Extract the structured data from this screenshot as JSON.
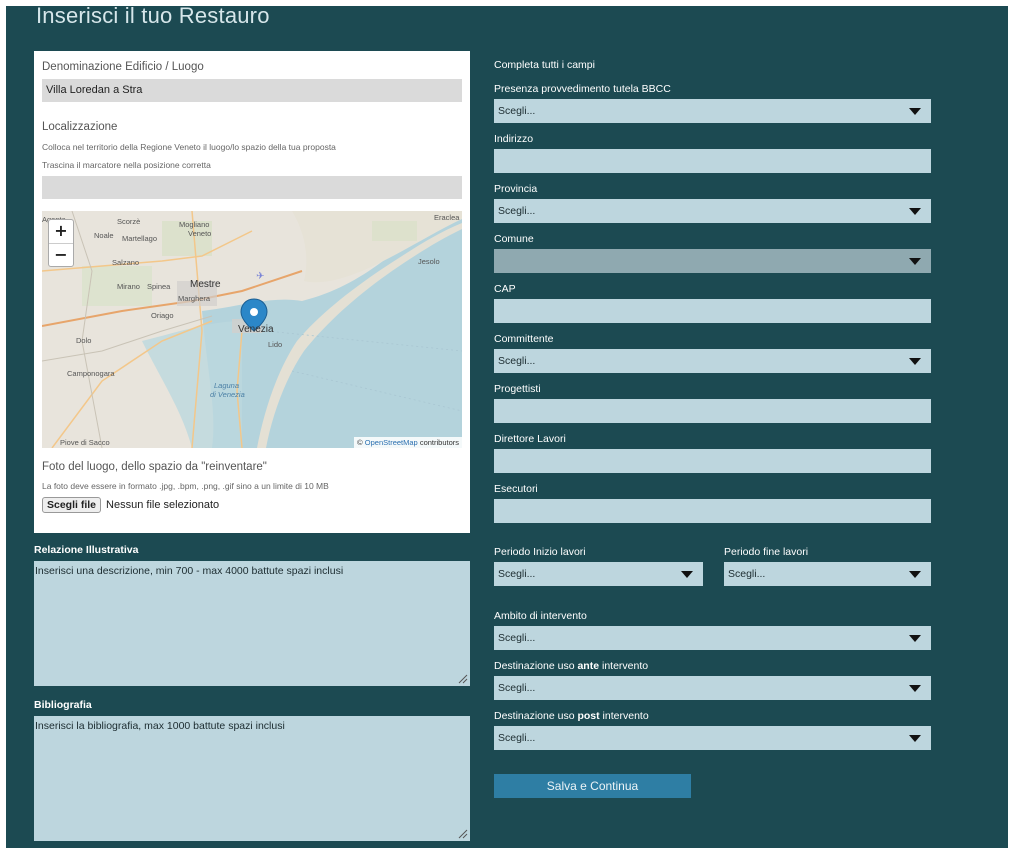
{
  "title": "Inserisci il tuo Restauro",
  "left": {
    "denominazione_label": "Denominazione Edificio / Luogo",
    "denominazione_value": "Villa Loredan a Stra",
    "localizzazione_label": "Localizzazione",
    "loc_hint1": "Colloca nel territorio della Regione Veneto il luogo/lo spazio della tua proposta",
    "loc_hint2": "Trascina il marcatore nella posizione corretta",
    "map": {
      "zoom_in": "+",
      "zoom_out": "−",
      "attribution_prefix": "©",
      "attribution_link": "OpenStreetMap",
      "attribution_suffix": "contributors",
      "labels": [
        "Scorzè",
        "Mogliano",
        "Veneto",
        "Noale",
        "Martellago",
        "Salzano",
        "Mirano",
        "Spinea",
        "Mestre",
        "Marghera",
        "Oriago",
        "Venezia",
        "Lido",
        "Dolo",
        "Camponogara",
        "Laguna",
        "di Venezia",
        "Piove di Sacco",
        "Eraclea",
        "Jesolo",
        "Agenta"
      ]
    },
    "foto_label": "Foto del luogo, dello spazio da \"reinventare\"",
    "foto_hint": "La foto deve essere in formato .jpg, .bpm, .png, .gif sino a un limite di 10 MB",
    "file_button": "Scegli file",
    "file_status": "Nessun file selezionato",
    "relazione_label": "Relazione Illustrativa",
    "relazione_placeholder": "Inserisci una descrizione, min 700 - max 4000 battute spazi inclusi",
    "bibliografia_label": "Bibliografia",
    "bibliografia_placeholder": "Inserisci la bibliografia, max 1000 battute spazi inclusi"
  },
  "right": {
    "completa": "Completa tutti i campi",
    "presenza_label": "Presenza provvedimento tutela BBCC",
    "presenza_value": "Scegli...",
    "indirizzo_label": "Indirizzo",
    "provincia_label": "Provincia",
    "provincia_value": "Scegli...",
    "comune_label": "Comune",
    "cap_label": "CAP",
    "committente_label": "Committente",
    "committente_value": "Scegli...",
    "progettisti_label": "Progettisti",
    "direttore_label": "Direttore Lavori",
    "esecutori_label": "Esecutori",
    "inizio_label": "Periodo Inizio lavori",
    "inizio_value": "Scegli...",
    "fine_label": "Periodo fine lavori",
    "fine_value": "Scegli...",
    "ambito_label": "Ambito di intervento",
    "ambito_value": "Scegli...",
    "ante_prefix": "Destinazione uso ",
    "ante_bold": "ante",
    "ante_suffix": " intervento",
    "ante_value": "Scegli...",
    "post_prefix": "Destinazione uso ",
    "post_bold": "post",
    "post_suffix": " intervento",
    "post_value": "Scegli...",
    "save_label": "Salva e Continua"
  },
  "colors": {
    "background": "#1c4a52",
    "field": "#bdd6de",
    "button": "#2e7ea4"
  }
}
